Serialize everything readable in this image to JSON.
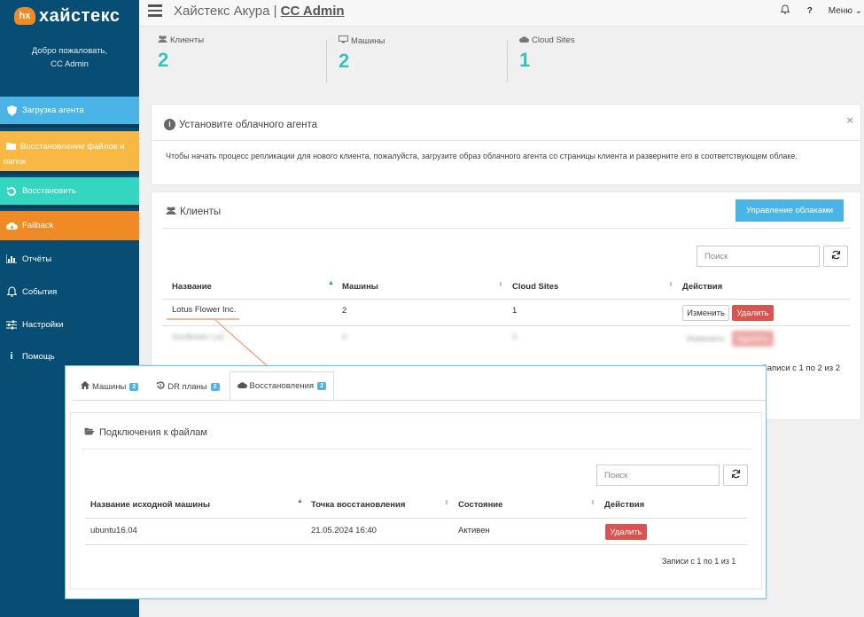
{
  "app": {
    "logo_badge": "hx",
    "logo_text": "хайстекс",
    "welcome": "Добро пожаловать,",
    "user": "CC Admin"
  },
  "sidebar": {
    "items": [
      {
        "label": "Загрузка агента",
        "icon": "shield-icon",
        "color": "#4bb4e6"
      },
      {
        "label": "Восстановление файлов и папок",
        "icon": "folder-open-icon",
        "color": "#f8b843"
      },
      {
        "label": "Восстановить",
        "icon": "restore-icon",
        "color": "#35d6c0"
      },
      {
        "label": "Failback",
        "icon": "cloud-download-icon",
        "color": "#f08a24"
      },
      {
        "label": "Отчёты",
        "icon": "bar-chart-icon"
      },
      {
        "label": "События",
        "icon": "bell-icon"
      },
      {
        "label": "Настройки",
        "icon": "sliders-icon"
      },
      {
        "label": "Помощь",
        "icon": "info-icon"
      }
    ]
  },
  "header": {
    "title": "Хайстекс Акура | ",
    "title_bold": "CC Admin",
    "help": "?",
    "menu": "Меню"
  },
  "stats": [
    {
      "label": "Клиенты",
      "value": "2",
      "icon": "users-icon"
    },
    {
      "label": "Машины",
      "value": "2",
      "icon": "monitor-icon"
    },
    {
      "label": "Cloud Sites",
      "value": "1",
      "icon": "cloud-icon"
    }
  ],
  "agent_panel": {
    "title": "Установите облачного агента",
    "close": "×",
    "text": "Чтобы начать процесс репликации для нового клиента, пожалуйста, загрузите образ облачного агента со страницы клиента и разверните его в соответствующем облаке."
  },
  "clients": {
    "title": "Клиенты",
    "manage_button": "Управление облаками",
    "search_placeholder": "Поиск",
    "columns": [
      "Название",
      "Машины",
      "Cloud Sites",
      "Действия"
    ],
    "rows": [
      {
        "name": "Lotus Flower Inc.",
        "machines": "2",
        "sites": "1",
        "edit": "Изменить",
        "delete": "Удалить"
      },
      {
        "name": "Sunflower Ltd",
        "machines": "0",
        "sites": "0",
        "edit": "Изменить",
        "delete": "Удалить"
      }
    ],
    "footer": "Записи с 1 по 2 из 2"
  },
  "detail": {
    "tabs": [
      {
        "label": "Машины",
        "badge": "2",
        "icon": "home-icon"
      },
      {
        "label": "DR планы",
        "badge": "2",
        "icon": "history-icon"
      },
      {
        "label": "Восстановления",
        "badge": "2",
        "icon": "cloud-icon"
      }
    ],
    "panel_title": "Подключения к файлам",
    "search_placeholder": "Поиск",
    "columns": [
      "Название исходной машины",
      "Точка восстановления",
      "Состояние",
      "Действия"
    ],
    "rows": [
      {
        "machine": "ubuntu16.04",
        "point": "21.05.2024 16:40",
        "state": "Активен",
        "delete": "Удалить"
      }
    ],
    "footer": "Записи с 1 по 1 из 1"
  },
  "colors": {
    "sidebar_bg": "#084d73",
    "accent_teal": "#35c5b8",
    "accent_blue": "#4bb4e6",
    "danger": "#d9534f",
    "arrow": "#f08a5a"
  }
}
